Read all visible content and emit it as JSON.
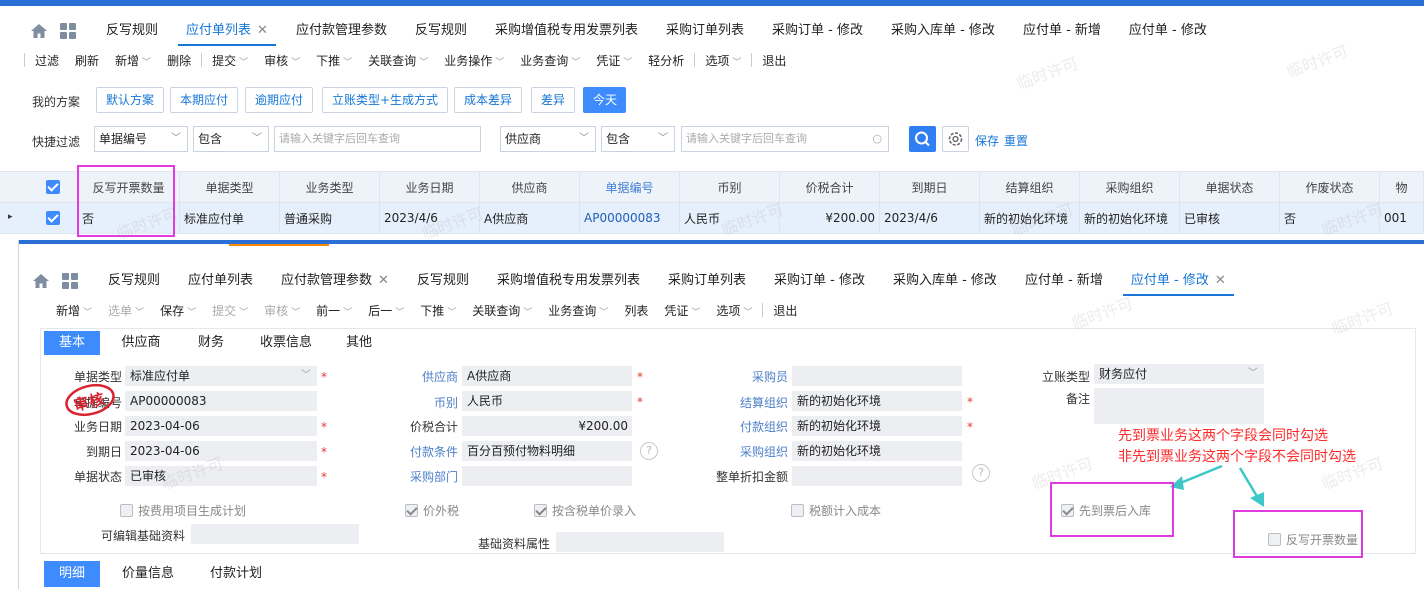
{
  "top_tabs": [
    {
      "label": "反写规则",
      "active": false,
      "closable": false
    },
    {
      "label": "应付单列表",
      "active": true,
      "closable": true
    },
    {
      "label": "应付款管理参数",
      "active": false,
      "closable": false
    },
    {
      "label": "反写规则",
      "active": false,
      "closable": false
    },
    {
      "label": "采购增值税专用发票列表",
      "active": false,
      "closable": false
    },
    {
      "label": "采购订单列表",
      "active": false,
      "closable": false
    },
    {
      "label": "采购订单 - 修改",
      "active": false,
      "closable": false
    },
    {
      "label": "采购入库单 - 修改",
      "active": false,
      "closable": false
    },
    {
      "label": "应付单 - 新增",
      "active": false,
      "closable": false
    },
    {
      "label": "应付单 - 修改",
      "active": false,
      "closable": false
    }
  ],
  "top_toolbar": [
    "过滤",
    "刷新",
    "新增",
    "删除",
    "提交",
    "审核",
    "下推",
    "关联查询",
    "业务操作",
    "业务查询",
    "凭证",
    "轻分析",
    "选项",
    "退出"
  ],
  "scheme": {
    "label": "我的方案",
    "buttons": [
      "默认方案",
      "本期应付",
      "逾期应付",
      "立账类型+生成方式",
      "成本差异",
      "差异",
      "今天"
    ]
  },
  "quick_filter": {
    "label": "快捷过滤",
    "field1": "单据编号",
    "op1": "包含",
    "placeholder1": "请输入关键字后回车查询",
    "field2": "供应商",
    "op2": "包含",
    "placeholder2": "请输入关键字后回车查询",
    "save": "保存",
    "reset": "重置"
  },
  "grid": {
    "columns": [
      "反写开票数量",
      "单据类型",
      "业务类型",
      "业务日期",
      "供应商",
      "单据编号",
      "币别",
      "价税合计",
      "到期日",
      "结算组织",
      "采购组织",
      "单据状态",
      "作废状态",
      "物"
    ],
    "row": [
      "否",
      "标准应付单",
      "普通采购",
      "2023/4/6",
      "A供应商",
      "AP00000083",
      "人民币",
      "¥200.00",
      "2023/4/6",
      "新的初始化环境",
      "新的初始化环境",
      "已审核",
      "否",
      "001"
    ]
  },
  "bottom_tabs": [
    {
      "label": "反写规则",
      "active": false,
      "closable": false
    },
    {
      "label": "应付单列表",
      "active": false,
      "closable": false
    },
    {
      "label": "应付款管理参数",
      "active": false,
      "closable": true
    },
    {
      "label": "反写规则",
      "active": false,
      "closable": false
    },
    {
      "label": "采购增值税专用发票列表",
      "active": false,
      "closable": false
    },
    {
      "label": "采购订单列表",
      "active": false,
      "closable": false
    },
    {
      "label": "采购订单 - 修改",
      "active": false,
      "closable": false
    },
    {
      "label": "采购入库单 - 修改",
      "active": false,
      "closable": false
    },
    {
      "label": "应付单 - 新增",
      "active": false,
      "closable": false
    },
    {
      "label": "应付单 - 修改",
      "active": true,
      "closable": true
    }
  ],
  "bottom_toolbar": [
    {
      "label": "新增",
      "dd": true,
      "dis": false
    },
    {
      "label": "选单",
      "dd": true,
      "dis": true
    },
    {
      "label": "保存",
      "dd": true,
      "dis": false
    },
    {
      "label": "提交",
      "dd": true,
      "dis": true
    },
    {
      "label": "审核",
      "dd": true,
      "dis": true
    },
    {
      "label": "前一",
      "dd": true,
      "dis": false
    },
    {
      "label": "后一",
      "dd": true,
      "dis": false
    },
    {
      "label": "下推",
      "dd": true,
      "dis": false
    },
    {
      "label": "关联查询",
      "dd": true,
      "dis": false
    },
    {
      "label": "业务查询",
      "dd": true,
      "dis": false
    },
    {
      "label": "列表",
      "dd": false,
      "dis": false
    },
    {
      "label": "凭证",
      "dd": true,
      "dis": false
    },
    {
      "label": "选项",
      "dd": true,
      "dis": false
    },
    {
      "label": "退出",
      "dd": false,
      "dis": false
    }
  ],
  "form_tabs": [
    "基本",
    "供应商",
    "财务",
    "收票信息",
    "其他"
  ],
  "form": {
    "bill_type_label": "单据类型",
    "bill_type": "标准应付单",
    "bill_no_label": "单据编号",
    "bill_no": "AP00000083",
    "biz_date_label": "业务日期",
    "biz_date": "2023-04-06",
    "due_date_label": "到期日",
    "due_date": "2023-04-06",
    "status_label": "单据状态",
    "status": "已审核",
    "stamp": "审核",
    "supplier_label": "供应商",
    "supplier": "A供应商",
    "currency_label": "币别",
    "currency": "人民币",
    "total_label": "价税合计",
    "total": "¥200.00",
    "payterm_label": "付款条件",
    "payterm": "百分百预付物料明细",
    "purdept_label": "采购部门",
    "buyer_label": "采购员",
    "settle_org_label": "结算组织",
    "settle_org": "新的初始化环境",
    "pay_org_label": "付款组织",
    "pay_org": "新的初始化环境",
    "pur_org_label": "采购组织",
    "pur_org": "新的初始化环境",
    "discount_label": "整单折扣金额",
    "acct_type_label": "立账类型",
    "acct_type": "财务应付",
    "remark_label": "备注",
    "cb_plan": "按费用项目生成计划",
    "cb_extra": "价外税",
    "cb_taxprice": "按含税单价录入",
    "cb_taxcost": "税额计入成本",
    "cb_first": "先到票后入库",
    "cb_reverse": "反写开票数量",
    "editable_label": "可编辑基础资料",
    "attr_label": "基础资料属性"
  },
  "annotation": {
    "line1": "先到票业务这两个字段会同时勾选",
    "line2": "非先到票业务这两个字段不会同时勾选",
    "color": "#ff2a2a"
  },
  "detail_tabs": [
    "明细",
    "价量信息",
    "付款计划"
  ],
  "watermark": "临时许可"
}
